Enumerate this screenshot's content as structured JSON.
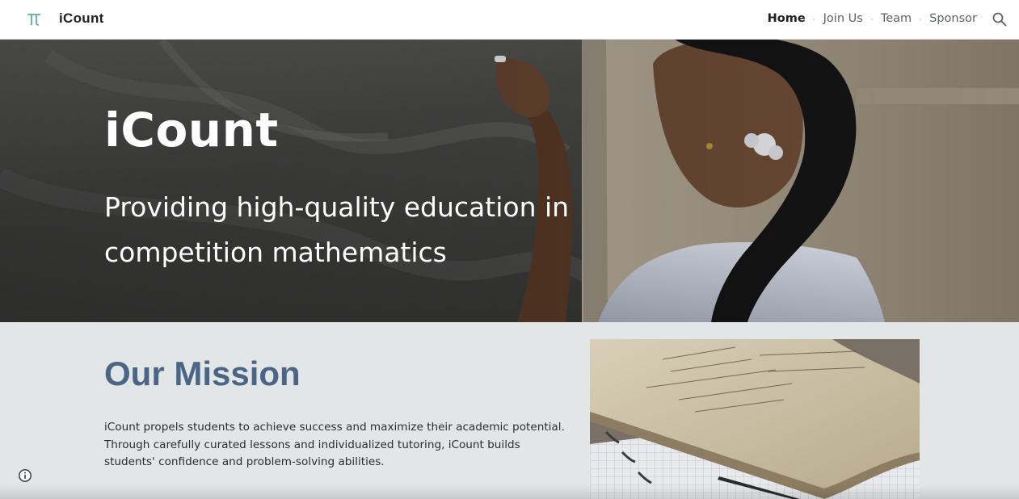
{
  "header": {
    "logo_icon": "pi-icon",
    "site_title": "iCount",
    "nav": [
      {
        "label": "Home",
        "active": true
      },
      {
        "label": "Join Us",
        "active": false
      },
      {
        "label": "Team",
        "active": false
      },
      {
        "label": "Sponsor",
        "active": false
      }
    ],
    "search_icon": "search-icon"
  },
  "hero": {
    "title": "iCount",
    "subtitle": "Providing high-quality education in competition mathematics"
  },
  "mission": {
    "title": "Our Mission",
    "text": "iCount propels students to achieve success and maximize their academic potential. Through carefully curated lessons and individualized tutoring, iCount builds students' confidence and problem-solving abilities."
  },
  "info_icon": "info-icon",
  "colors": {
    "accent": "#4a6585",
    "logo": "#5ab3a3",
    "mission_bg": "#e3e6e7"
  }
}
